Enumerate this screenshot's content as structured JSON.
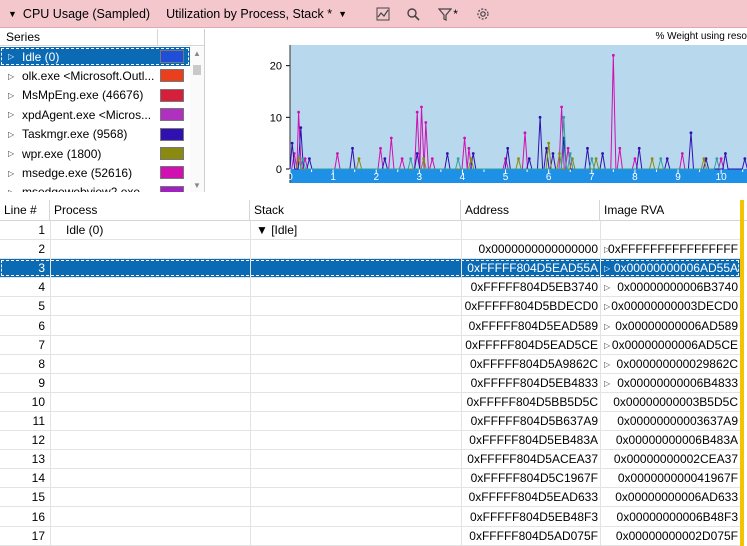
{
  "titlebar": {
    "title": "CPU Usage (Sampled)",
    "view": "Utilization by Process, Stack *",
    "icons": [
      "chart-view-icon",
      "search-icon",
      "filter-icon",
      "settings-icon"
    ],
    "filter_mark": "*"
  },
  "series": {
    "header": "Series",
    "items": [
      {
        "label": "Idle (0)",
        "color": "#1f4fd8",
        "selected": true
      },
      {
        "label": "olk.exe <Microsoft.Outl...",
        "color": "#e8401c",
        "selected": false
      },
      {
        "label": "MsMpEng.exe (46676)",
        "color": "#d4203a",
        "selected": false
      },
      {
        "label": "xpdAgent.exe <Micros...",
        "color": "#b030c0",
        "selected": false
      },
      {
        "label": "Taskmgr.exe (9568)",
        "color": "#3010b0",
        "selected": false
      },
      {
        "label": "wpr.exe (1800)",
        "color": "#8a8a10",
        "selected": false
      },
      {
        "label": "msedge.exe (52616)",
        "color": "#d010b0",
        "selected": false
      },
      {
        "label": "msedgewebview2.exe",
        "color": "#a020c0",
        "selected": false
      }
    ]
  },
  "chart": {
    "weight_label": "% Weight using reso",
    "y_ticks": [
      "20",
      "10",
      "0"
    ],
    "x_ticks": [
      "0",
      "1",
      "2",
      "3",
      "4",
      "5",
      "6",
      "7",
      "8",
      "9",
      "10"
    ],
    "background": "#b8d8ee",
    "axis_bar": "#1e90e6"
  },
  "chart_data": {
    "type": "line",
    "ylim": [
      0,
      24
    ],
    "xlim": [
      0,
      10.6
    ],
    "ylabel": "",
    "xlabel": "",
    "series": [
      {
        "color": "#d010b0",
        "points": [
          [
            0.1,
            3
          ],
          [
            0.2,
            11
          ],
          [
            0.35,
            2
          ],
          [
            1.1,
            3
          ],
          [
            2.1,
            4
          ],
          [
            2.35,
            6
          ],
          [
            2.6,
            2
          ],
          [
            2.95,
            11
          ],
          [
            3.05,
            12
          ],
          [
            3.15,
            9
          ],
          [
            3.3,
            2
          ],
          [
            4.05,
            6
          ],
          [
            4.15,
            4
          ],
          [
            5.0,
            2
          ],
          [
            5.45,
            7
          ],
          [
            6.3,
            12
          ],
          [
            6.45,
            4
          ],
          [
            7.5,
            22
          ],
          [
            7.65,
            4
          ],
          [
            8.0,
            2
          ],
          [
            9.1,
            3
          ],
          [
            10.0,
            2
          ]
        ]
      },
      {
        "color": "#3010b0",
        "points": [
          [
            0.05,
            5
          ],
          [
            0.25,
            8
          ],
          [
            0.45,
            2
          ],
          [
            1.45,
            4
          ],
          [
            2.2,
            2
          ],
          [
            2.95,
            3
          ],
          [
            3.65,
            3
          ],
          [
            4.25,
            3
          ],
          [
            5.05,
            4
          ],
          [
            5.55,
            2
          ],
          [
            5.8,
            10
          ],
          [
            5.95,
            4
          ],
          [
            6.1,
            3
          ],
          [
            6.35,
            6
          ],
          [
            6.9,
            4
          ],
          [
            7.25,
            3
          ],
          [
            8.1,
            4
          ],
          [
            8.75,
            2
          ],
          [
            9.3,
            7
          ],
          [
            9.65,
            2
          ],
          [
            10.1,
            3
          ],
          [
            10.55,
            2
          ]
        ]
      },
      {
        "color": "#8a8a10",
        "points": [
          [
            0.2,
            2
          ],
          [
            1.6,
            2
          ],
          [
            3.1,
            2
          ],
          [
            4.2,
            2
          ],
          [
            5.3,
            2
          ],
          [
            6.0,
            5
          ],
          [
            6.25,
            3
          ],
          [
            6.55,
            2
          ],
          [
            7.1,
            2
          ],
          [
            8.4,
            2
          ],
          [
            9.6,
            2
          ]
        ]
      },
      {
        "color": "#30a0a0",
        "points": [
          [
            0.3,
            2
          ],
          [
            2.8,
            2
          ],
          [
            3.9,
            2
          ],
          [
            6.35,
            10
          ],
          [
            6.5,
            3
          ],
          [
            7.0,
            2
          ],
          [
            8.6,
            2
          ],
          [
            9.9,
            2
          ]
        ]
      }
    ]
  },
  "table": {
    "columns": [
      "Line #",
      "Process",
      "Stack",
      "Address",
      "Image RVA"
    ],
    "rows": [
      {
        "line": "1",
        "process": "Idle (0)",
        "stack": "▼ [Idle]",
        "address": "",
        "expand": "",
        "rva": "",
        "selected": false
      },
      {
        "line": "2",
        "process": "",
        "stack": "",
        "address": "0x0000000000000000",
        "expand": "▷",
        "rva": "0xFFFFFFFFFFFFFFFF",
        "selected": false
      },
      {
        "line": "3",
        "process": "",
        "stack": "",
        "address": "0xFFFFF804D5EAD55A",
        "expand": "▷",
        "rva": "0x00000000006AD55A",
        "selected": true
      },
      {
        "line": "4",
        "process": "",
        "stack": "",
        "address": "0xFFFFF804D5EB3740",
        "expand": "▷",
        "rva": "0x00000000006B3740",
        "selected": false
      },
      {
        "line": "5",
        "process": "",
        "stack": "",
        "address": "0xFFFFF804D5BDECD0",
        "expand": "▷",
        "rva": "0x00000000003DECD0",
        "selected": false
      },
      {
        "line": "6",
        "process": "",
        "stack": "",
        "address": "0xFFFFF804D5EAD589",
        "expand": "▷",
        "rva": "0x00000000006AD589",
        "selected": false
      },
      {
        "line": "7",
        "process": "",
        "stack": "",
        "address": "0xFFFFF804D5EAD5CE",
        "expand": "▷",
        "rva": "0x00000000006AD5CE",
        "selected": false
      },
      {
        "line": "8",
        "process": "",
        "stack": "",
        "address": "0xFFFFF804D5A9862C",
        "expand": "▷",
        "rva": "0x000000000029862C",
        "selected": false
      },
      {
        "line": "9",
        "process": "",
        "stack": "",
        "address": "0xFFFFF804D5EB4833",
        "expand": "▷",
        "rva": "0x00000000006B4833",
        "selected": false
      },
      {
        "line": "10",
        "process": "",
        "stack": "",
        "address": "0xFFFFF804D5BB5D5C",
        "expand": "",
        "rva": "0x00000000003B5D5C",
        "selected": false
      },
      {
        "line": "11",
        "process": "",
        "stack": "",
        "address": "0xFFFFF804D5B637A9",
        "expand": "",
        "rva": "0x00000000003637A9",
        "selected": false
      },
      {
        "line": "12",
        "process": "",
        "stack": "",
        "address": "0xFFFFF804D5EB483A",
        "expand": "",
        "rva": "0x00000000006B483A",
        "selected": false
      },
      {
        "line": "13",
        "process": "",
        "stack": "",
        "address": "0xFFFFF804D5ACEA37",
        "expand": "",
        "rva": "0x00000000002CEA37",
        "selected": false
      },
      {
        "line": "14",
        "process": "",
        "stack": "",
        "address": "0xFFFFF804D5C1967F",
        "expand": "",
        "rva": "0x000000000041967F",
        "selected": false
      },
      {
        "line": "15",
        "process": "",
        "stack": "",
        "address": "0xFFFFF804D5EAD633",
        "expand": "",
        "rva": "0x00000000006AD633",
        "selected": false
      },
      {
        "line": "16",
        "process": "",
        "stack": "",
        "address": "0xFFFFF804D5EB48F3",
        "expand": "",
        "rva": "0x00000000006B48F3",
        "selected": false
      },
      {
        "line": "17",
        "process": "",
        "stack": "",
        "address": "0xFFFFF804D5AD075F",
        "expand": "",
        "rva": "0x00000000002D075F",
        "selected": false
      }
    ]
  }
}
